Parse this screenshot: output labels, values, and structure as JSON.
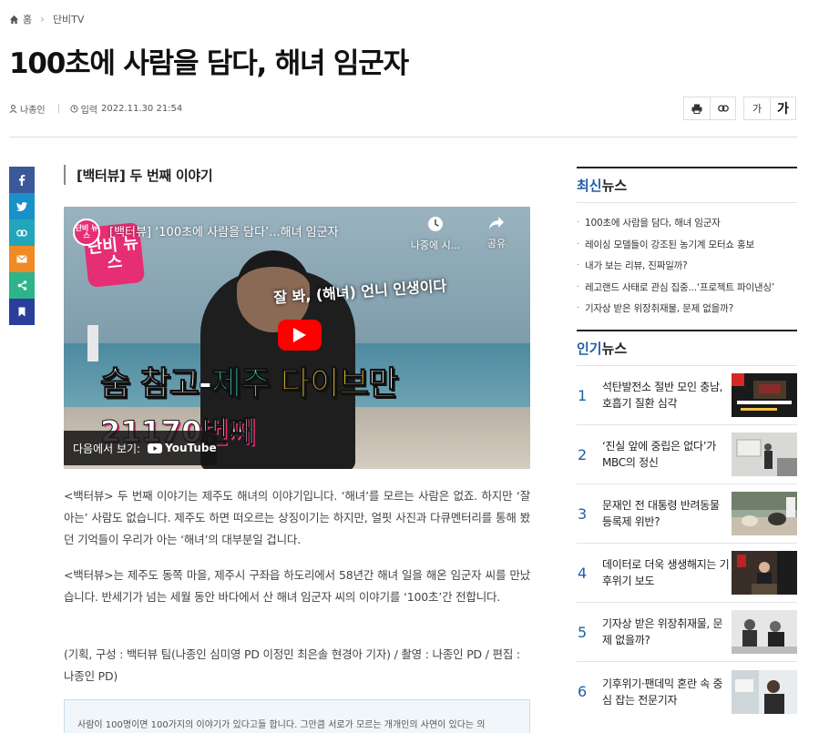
{
  "breadcrumb": {
    "home": "홈",
    "section": "단비TV"
  },
  "article": {
    "title": "100초에 사람을 담다, 해녀 임군자",
    "author": "나종인",
    "date_label": "입력",
    "date": "2022.11.30 21:54",
    "subheading": "[백터뷰] 두 번째 이야기",
    "paragraphs": [
      "<백터뷰> 두 번째 이야기는 제주도 해녀의 이야기입니다. ‘해녀’를 모르는 사람은 없죠. 하지만 ‘잘 아는’ 사람도 없습니다. 제주도 하면 떠오르는 상징이기는 하지만, 얼핏 사진과 다큐멘터리를 통해 봤던 기억들이 우리가 아는 ‘해녀’의 대부분일 겁니다.",
      "<백터뷰>는 제주도 동쪽 마을, 제주시 구좌읍 하도리에서 58년간 해녀 일을 해온 임군자 씨를 만났습니다. 반세기가 넘는 세월 동안 바다에서 산 해녀 임군자 씨의 이야기를 ‘100초’간 전합니다."
    ],
    "credit": "(기획, 구성 : 백터뷰 팀(나종인 심미영 PD 이정민 최은솔 현경아 기자) /  촬영 : 나종인 PD / 편집 : 나종인 PD)",
    "info_box": "사람이 100명이면 100가지의 이야기가 있다고들 합니다. 그만큼 서로가 모르는 개개인의 사연이 있다는 의"
  },
  "tools": {
    "font_small": "가",
    "font_large": "가"
  },
  "video": {
    "channel_avatar": "단비 뉴스",
    "logo": "단비 뉴스",
    "title": "[백터뷰] ‘100초에 사람을 담다’...해녀 임군자",
    "watch_later": "나중에 시...",
    "share": "공유",
    "caption_small": "잘 봐, (해녀) 언니 인생이다",
    "caption_big_1": "숨 참고-",
    "caption_big_2": "제주 ",
    "caption_big_3": "다이브",
    "caption_big_4": "만",
    "caption_count": "21170번째",
    "watch_on": "다음에서 보기:",
    "youtube": "YouTube"
  },
  "sidebar": {
    "latest_head_accent": "최신",
    "latest_head_rest": "뉴스",
    "latest": [
      "100초에 사람을 담다, 해녀 임군자",
      "레이싱 모델들이 강조된 농기계 모터쇼 홍보",
      "내가 보는 리뷰, 진짜일까?",
      "레고랜드 사태로 관심 집중...‘프로젝트 파이낸싱’",
      "기자상 받은 위장취재물, 문제 없을까?"
    ],
    "popular_head_accent": "인기",
    "popular_head_rest": "뉴스",
    "popular": [
      {
        "num": "1",
        "title": "석탄발전소 절반 모인 충남, 호흡기 질환 심각"
      },
      {
        "num": "2",
        "title": "‘진실 앞에 중립은 없다’가 MBC의 정신"
      },
      {
        "num": "3",
        "title": "문재인 전 대통령 반려동물 등록제 위반?"
      },
      {
        "num": "4",
        "title": "데이터로 더욱 생생해지는 기후위기 보도"
      },
      {
        "num": "5",
        "title": "기자상 받은 위장취재물, 문제 없을까?"
      },
      {
        "num": "6",
        "title": "기후위기·팬데믹 혼란 속 중심 잡는 전문기자"
      }
    ]
  },
  "colors": {
    "accent": "#1f5fa8",
    "facebook": "#3b5998",
    "twitter": "#1a90c8",
    "link": "#22a5b8",
    "mail": "#f08a24",
    "share": "#2db48a",
    "bookmark": "#2a3e9c",
    "youtube_red": "#ff0000"
  }
}
